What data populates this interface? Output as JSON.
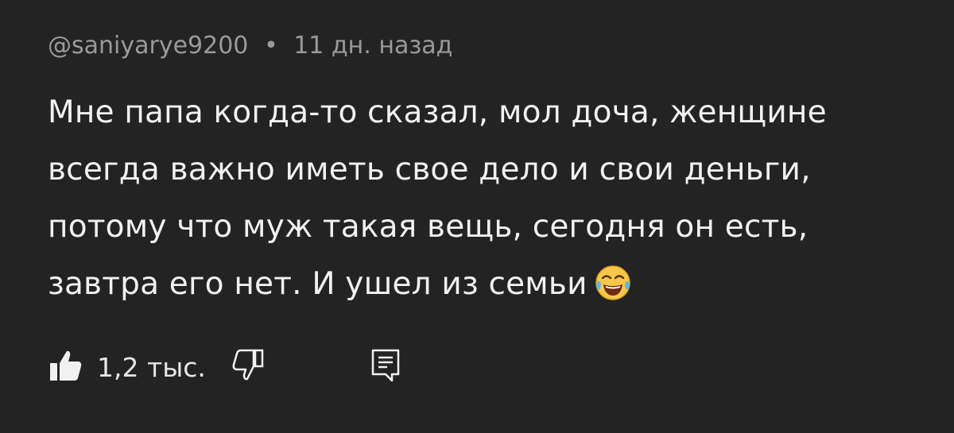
{
  "comment": {
    "author": "@saniyarye9200",
    "separator": "•",
    "time": "11 дн. назад",
    "lines": [
      "Мне папа когда-то сказал, мол доча, женщине",
      "всегда важно иметь свое дело и свои деньги,",
      "потому что муж такая вещь, сегодня он есть,",
      "завтра его нет. И ушел из семьи"
    ],
    "emoji": "face-with-tears-of-joy-icon"
  },
  "actions": {
    "like_count": "1,2 тыс.",
    "like_icon": "thumbs-up-icon",
    "dislike_icon": "thumbs-down-icon",
    "reply_icon": "reply-comment-icon"
  },
  "colors": {
    "background": "#232323",
    "text": "#f1f1f1",
    "meta": "#9a9a9a"
  }
}
